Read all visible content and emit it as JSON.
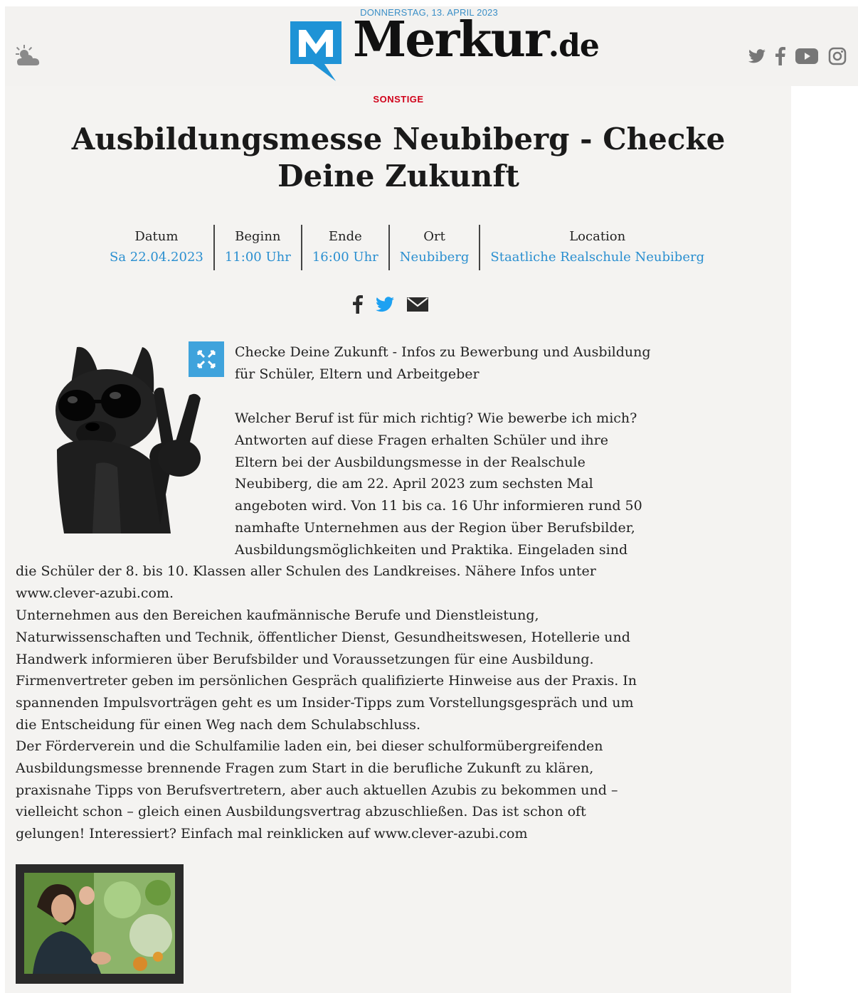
{
  "header": {
    "date": "DONNERSTAG, 13. APRIL 2023",
    "brand_name": "Merkur",
    "brand_tld": ".de",
    "brand_color": "#1f93d6",
    "weather_icon": "weather-cloud-sun-icon",
    "social_icons": [
      "twitter-icon",
      "facebook-icon",
      "youtube-icon",
      "instagram-icon"
    ]
  },
  "article": {
    "category": "SONSTIGE",
    "title": "Ausbildungsmesse Neubiberg - Checke Deine Zukunft",
    "meta": [
      {
        "label": "Datum",
        "value": "Sa 22.04.2023"
      },
      {
        "label": "Beginn",
        "value": "11:00 Uhr"
      },
      {
        "label": "Ende",
        "value": "16:00 Uhr"
      },
      {
        "label": "Ort",
        "value": "Neubiberg"
      },
      {
        "label": "Location",
        "value": "Staatliche Realschule Neubiberg"
      }
    ],
    "share_icons": [
      "facebook-share-icon",
      "twitter-share-icon",
      "email-share-icon"
    ],
    "intro": "Checke Deine Zukunft - Infos zu Bewerbung und Ausbildung für Schüler, Eltern und Arbeitgeber",
    "paragraph_2a": "Welcher Beruf ist für mich richtig? Wie bewerbe ich mich? Antworten auf diese Fragen erhalten Schüler und ihre Eltern bei der Ausbildungsmesse in der Realschule Neubiberg, die am 22. April 2023 zum sechsten Mal angeboten wird. Von 11 bis ca. 16 Uhr informieren rund 50 namhafte Unternehmen aus der Region über Berufsbilder, Ausbildungsmöglichkeiten und Praktika. Eingeladen sind",
    "paragraph_2b": "die Schüler der 8. bis 10. Klassen aller Schulen des Landkreises. Nähere Infos unter www.clever-azubi.com.",
    "paragraph_3": "Unternehmen aus den Bereichen kaufmännische Berufe und Dienstleistung, Naturwissenschaften und Technik, öffentlicher Dienst, Gesundheitswesen, Hotellerie und Handwerk informieren über Berufsbilder und Voraussetzungen für eine Ausbildung. Firmenvertreter geben im persönlichen Gespräch qualifizierte Hinweise aus der Praxis. In spannenden Impulsvorträgen geht es um Insider-Tipps zum Vorstellungsgespräch und um die Entscheidung für einen Weg nach dem Schulabschluss.",
    "paragraph_4": "Der Förderverein und die Schulfamilie laden ein, bei dieser schulformübergreifenden Ausbildungsmesse brennende Fragen zum Start in die berufliche Zukunft zu klären, praxisnahe Tipps von Berufsvertretern, aber auch aktuellen Azubis zu bekommen und – vielleicht schon – gleich einen Ausbildungsvertrag abzuschließen. Das ist schon oft gelungen! Interessiert? Einfach mal reinklicken auf www.clever-azubi.com"
  }
}
